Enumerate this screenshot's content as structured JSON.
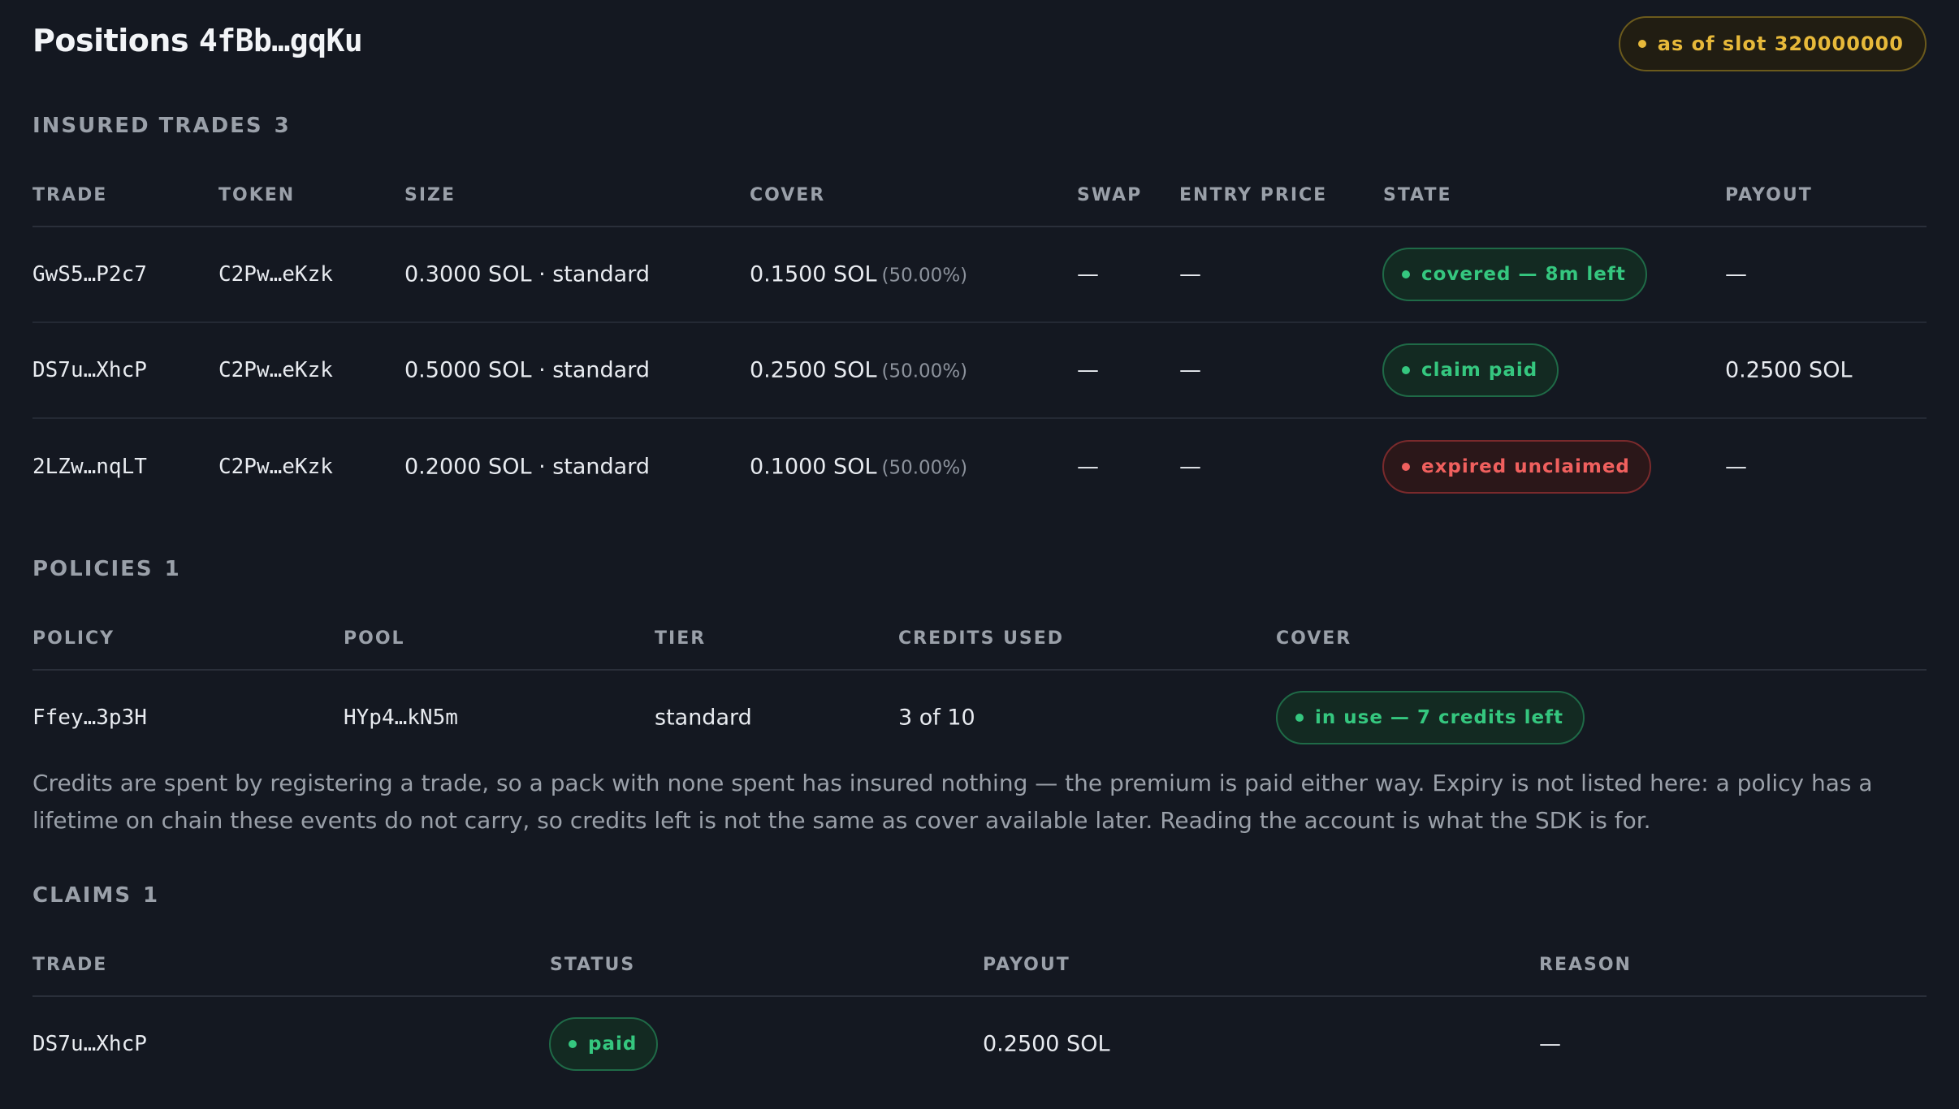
{
  "header": {
    "title_prefix": "Positions",
    "address": "4fBb…gqKu",
    "slot_badge": "as of slot 320000000"
  },
  "colors": {
    "background": "#141821",
    "accent_amber": "#e7b93a",
    "status_green": "#35c77f",
    "status_red": "#f0605e"
  },
  "insured_trades": {
    "heading": "INSURED TRADES",
    "count": "3",
    "columns": [
      "TRADE",
      "TOKEN",
      "SIZE",
      "COVER",
      "SWAP",
      "ENTRY PRICE",
      "STATE",
      "PAYOUT"
    ],
    "rows": [
      {
        "trade": "GwS5…P2c7",
        "token": "C2Pw…eKzk",
        "size": "0.3000 SOL · standard",
        "cover": "0.1500 SOL",
        "cover_pct": "(50.00%)",
        "swap": "—",
        "entry_price": "—",
        "state": "covered — 8m left",
        "state_tone": "green",
        "payout": "—"
      },
      {
        "trade": "DS7u…XhcP",
        "token": "C2Pw…eKzk",
        "size": "0.5000 SOL · standard",
        "cover": "0.2500 SOL",
        "cover_pct": "(50.00%)",
        "swap": "—",
        "entry_price": "—",
        "state": "claim paid",
        "state_tone": "green",
        "payout": "0.2500 SOL"
      },
      {
        "trade": "2LZw…nqLT",
        "token": "C2Pw…eKzk",
        "size": "0.2000 SOL · standard",
        "cover": "0.1000 SOL",
        "cover_pct": "(50.00%)",
        "swap": "—",
        "entry_price": "—",
        "state": "expired unclaimed",
        "state_tone": "red",
        "payout": "—"
      }
    ]
  },
  "policies": {
    "heading": "POLICIES",
    "count": "1",
    "columns": [
      "POLICY",
      "POOL",
      "TIER",
      "CREDITS USED",
      "COVER"
    ],
    "rows": [
      {
        "policy": "Ffey…3p3H",
        "pool": "HYp4…kN5m",
        "tier": "standard",
        "credits_used": "3 of 10",
        "cover": "in use — 7 credits left"
      }
    ],
    "note": "Credits are spent by registering a trade, so a pack with none spent has insured nothing — the premium is paid either way. Expiry is not listed here: a policy has a lifetime on chain these events do not carry, so credits left is not the same as cover available later. Reading the account is what the SDK is for."
  },
  "claims": {
    "heading": "CLAIMS",
    "count": "1",
    "columns": [
      "TRADE",
      "STATUS",
      "PAYOUT",
      "REASON"
    ],
    "rows": [
      {
        "trade": "DS7u…XhcP",
        "status": "paid",
        "payout": "0.2500 SOL",
        "reason": "—"
      }
    ]
  }
}
